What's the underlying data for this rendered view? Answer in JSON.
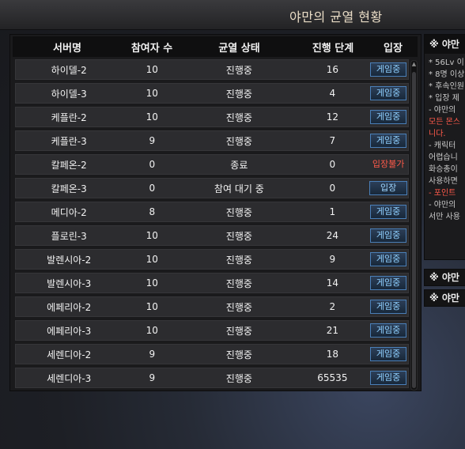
{
  "window": {
    "title": "야만의 균열 현황"
  },
  "table": {
    "headers": [
      "서버명",
      "참여자 수",
      "균열 상태",
      "진행 단계",
      "입장"
    ],
    "rows": [
      {
        "server": "하이델-2",
        "participants": "10",
        "status": "진행중",
        "stage": "16",
        "action": "게임중",
        "action_type": "ingame"
      },
      {
        "server": "하이델-3",
        "participants": "10",
        "status": "진행중",
        "stage": "4",
        "action": "게임중",
        "action_type": "ingame"
      },
      {
        "server": "케플란-2",
        "participants": "10",
        "status": "진행중",
        "stage": "12",
        "action": "게임중",
        "action_type": "ingame"
      },
      {
        "server": "케플란-3",
        "participants": "9",
        "status": "진행중",
        "stage": "7",
        "action": "게임중",
        "action_type": "ingame"
      },
      {
        "server": "칼페온-2",
        "participants": "0",
        "status": "종료",
        "stage": "0",
        "action": "입장불가",
        "action_type": "blocked"
      },
      {
        "server": "칼페온-3",
        "participants": "0",
        "status": "참여 대기 중",
        "stage": "0",
        "action": "입장",
        "action_type": "open"
      },
      {
        "server": "메디아-2",
        "participants": "8",
        "status": "진행중",
        "stage": "1",
        "action": "게임중",
        "action_type": "ingame"
      },
      {
        "server": "플로린-3",
        "participants": "10",
        "status": "진행중",
        "stage": "24",
        "action": "게임중",
        "action_type": "ingame"
      },
      {
        "server": "발렌시아-2",
        "participants": "10",
        "status": "진행중",
        "stage": "9",
        "action": "게임중",
        "action_type": "ingame"
      },
      {
        "server": "발렌시아-3",
        "participants": "10",
        "status": "진행중",
        "stage": "14",
        "action": "게임중",
        "action_type": "ingame"
      },
      {
        "server": "에페리아-2",
        "participants": "10",
        "status": "진행중",
        "stage": "2",
        "action": "게임중",
        "action_type": "ingame"
      },
      {
        "server": "에페리아-3",
        "participants": "10",
        "status": "진행중",
        "stage": "21",
        "action": "게임중",
        "action_type": "ingame"
      },
      {
        "server": "세렌디아-2",
        "participants": "9",
        "status": "진행중",
        "stage": "18",
        "action": "게임중",
        "action_type": "ingame"
      },
      {
        "server": "세렌디아-3",
        "participants": "9",
        "status": "진행중",
        "stage": "65535",
        "action": "게임중",
        "action_type": "ingame"
      }
    ]
  },
  "side": {
    "header": "※ 야만",
    "lines": [
      {
        "text": "* 56Lv 이",
        "red": false
      },
      {
        "text": "* 8명 이상",
        "red": false
      },
      {
        "text": "* 후속인원",
        "red": false
      },
      {
        "text": "* 입장 제",
        "red": false
      },
      {
        "text": "- 야만의",
        "red": false
      },
      {
        "text": "모든 몬스",
        "red": true
      },
      {
        "text": "니다.",
        "red": true
      },
      {
        "text": "- 캐릭터",
        "red": false
      },
      {
        "text": "어렵습니",
        "red": false
      },
      {
        "text": "화승총이",
        "red": false
      },
      {
        "text": "사용하면",
        "red": false
      },
      {
        "text": "- 포인트",
        "red": true
      },
      {
        "text": "- 야만의",
        "red": false
      },
      {
        "text": "서만 사용",
        "red": false
      }
    ],
    "box1": "※ 야만",
    "box2": "※ 야만"
  },
  "colors": {
    "ingame": "#8fd0ff",
    "blocked": "#ff5a4a",
    "panel": "#1a1a1c"
  }
}
